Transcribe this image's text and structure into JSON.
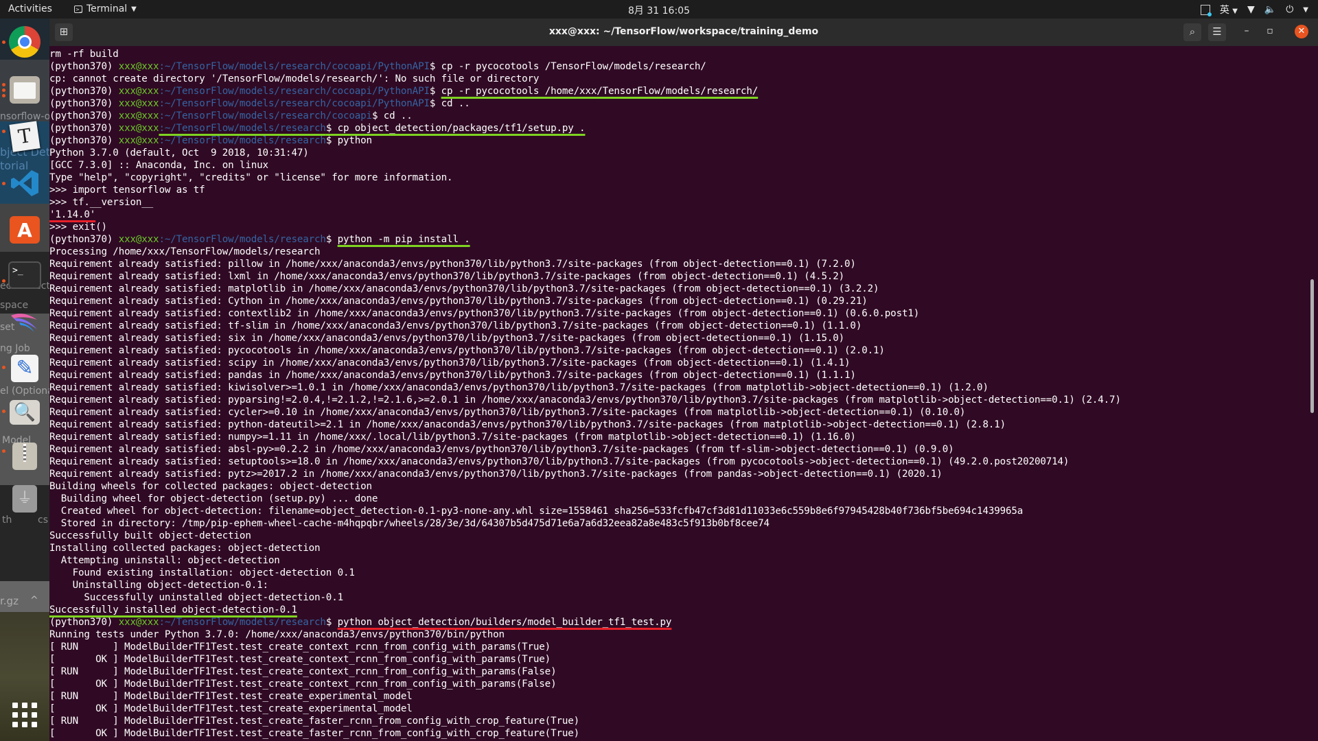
{
  "topbar": {
    "activities": "Activities",
    "app_menu": "Terminal",
    "datetime": "8月 31  16:05",
    "input_method": "英",
    "icons": [
      "screenshot-indicator-icon",
      "wifi-icon",
      "volume-icon",
      "power-icon"
    ]
  },
  "dock": {
    "apps": [
      {
        "name": "Google Chrome",
        "icon": "chrome-icon",
        "running": true
      },
      {
        "name": "Files",
        "icon": "folder-icon",
        "running": true
      },
      {
        "name": "Typora",
        "icon": "typora-icon",
        "running": true
      },
      {
        "name": "Visual Studio Code",
        "icon": "vscode-icon",
        "running": true
      },
      {
        "name": "Ubuntu Software",
        "icon": "software-store-icon",
        "running": false
      },
      {
        "name": "Terminal",
        "icon": "terminal-icon",
        "running": true
      },
      {
        "name": "Kite",
        "icon": "kite-icon",
        "running": false
      },
      {
        "name": "Text Editor",
        "icon": "text-editor-icon",
        "running": true
      },
      {
        "name": "Image Viewer",
        "icon": "image-viewer-icon",
        "running": true
      },
      {
        "name": "Archive Manager",
        "icon": "archive-icon",
        "running": true
      },
      {
        "name": "USB Drive",
        "icon": "usb-icon",
        "running": false
      }
    ],
    "show_apps": "show-applications-icon",
    "background_fragments": [
      "nsorflow-obj",
      "bject Dete",
      "torial",
      "ect Detecto",
      "space",
      "set",
      "ng Job",
      "el (Optional",
      "Model",
      "th",
      "cs!",
      "r.gz"
    ]
  },
  "window": {
    "title": "xxx@xxx: ~/TensorFlow/workspace/training_demo",
    "buttons": {
      "new_tab": "new-tab-icon",
      "search": "search-icon",
      "menu": "hamburger-menu-icon",
      "minimize": "minimize-icon",
      "maximize": "maximize-icon",
      "close": "close-icon"
    }
  },
  "colors": {
    "terminal_bg": "#300a24",
    "prompt_user": "#6bc72a",
    "prompt_path": "#3465a4",
    "underline_green": "#7ed321",
    "underline_red": "#e8202a",
    "close_button": "#e95420"
  },
  "terminal": {
    "lines": [
      {
        "text": "rm -rf build"
      },
      {
        "env": "(python370) ",
        "user": "xxx@xxx",
        "path": ":~/TensorFlow/models/research/cocoapi/PythonAPI",
        "cmd": "$ cp -r pycocotools /TensorFlow/models/research/"
      },
      {
        "text": "cp: cannot create directory '/TensorFlow/models/research/': No such file or directory"
      },
      {
        "env": "(python370) ",
        "user": "xxx@xxx",
        "path": ":~/TensorFlow/models/research/cocoapi/PythonAPI",
        "cmd": "$ ",
        "cmd_marked": "cp -r pycocotools /home/xxx/TensorFlow/models/research/",
        "mark": "green"
      },
      {
        "env": "(python370) ",
        "user": "xxx@xxx",
        "path": ":~/TensorFlow/models/research/cocoapi/PythonAPI",
        "cmd": "$ cd .."
      },
      {
        "env": "(python370) ",
        "user": "xxx@xxx",
        "path": ":~/TensorFlow/models/research/cocoapi",
        "cmd": "$ cd .."
      },
      {
        "env": "(python370) ",
        "user": "xxx@xxx",
        "path": ":~/TensorFlow/models/research",
        "cmd": "$ cp object_detection/packages/tf1/setup.py .",
        "path_marked": true,
        "mark": "green"
      },
      {
        "env": "(python370) ",
        "user": "xxx@xxx",
        "path": ":~/TensorFlow/models/research",
        "cmd": "$ python"
      },
      {
        "text": "Python 3.7.0 (default, Oct  9 2018, 10:31:47)"
      },
      {
        "text": "[GCC 7.3.0] :: Anaconda, Inc. on linux"
      },
      {
        "text": "Type \"help\", \"copyright\", \"credits\" or \"license\" for more information."
      },
      {
        "text": ">>> import tensorflow as tf"
      },
      {
        "text": ">>> tf.__version__"
      },
      {
        "text": "'1.14.0'",
        "mark": "red",
        "whole": true
      },
      {
        "text": ">>> exit()"
      },
      {
        "env": "(python370) ",
        "user": "xxx@xxx",
        "path": ":~/TensorFlow/models/research",
        "cmd": "$ ",
        "cmd_marked": "python -m pip install .",
        "mark": "green"
      },
      {
        "text": "Processing /home/xxx/TensorFlow/models/research"
      },
      {
        "text": "Requirement already satisfied: pillow in /home/xxx/anaconda3/envs/python370/lib/python3.7/site-packages (from object-detection==0.1) (7.2.0)"
      },
      {
        "text": "Requirement already satisfied: lxml in /home/xxx/anaconda3/envs/python370/lib/python3.7/site-packages (from object-detection==0.1) (4.5.2)"
      },
      {
        "text": "Requirement already satisfied: matplotlib in /home/xxx/anaconda3/envs/python370/lib/python3.7/site-packages (from object-detection==0.1) (3.2.2)"
      },
      {
        "text": "Requirement already satisfied: Cython in /home/xxx/anaconda3/envs/python370/lib/python3.7/site-packages (from object-detection==0.1) (0.29.21)"
      },
      {
        "text": "Requirement already satisfied: contextlib2 in /home/xxx/anaconda3/envs/python370/lib/python3.7/site-packages (from object-detection==0.1) (0.6.0.post1)"
      },
      {
        "text": "Requirement already satisfied: tf-slim in /home/xxx/anaconda3/envs/python370/lib/python3.7/site-packages (from object-detection==0.1) (1.1.0)"
      },
      {
        "text": "Requirement already satisfied: six in /home/xxx/anaconda3/envs/python370/lib/python3.7/site-packages (from object-detection==0.1) (1.15.0)"
      },
      {
        "text": "Requirement already satisfied: pycocotools in /home/xxx/anaconda3/envs/python370/lib/python3.7/site-packages (from object-detection==0.1) (2.0.1)"
      },
      {
        "text": "Requirement already satisfied: scipy in /home/xxx/anaconda3/envs/python370/lib/python3.7/site-packages (from object-detection==0.1) (1.4.1)"
      },
      {
        "text": "Requirement already satisfied: pandas in /home/xxx/anaconda3/envs/python370/lib/python3.7/site-packages (from object-detection==0.1) (1.1.1)"
      },
      {
        "text": "Requirement already satisfied: kiwisolver>=1.0.1 in /home/xxx/anaconda3/envs/python370/lib/python3.7/site-packages (from matplotlib->object-detection==0.1) (1.2.0)"
      },
      {
        "text": "Requirement already satisfied: pyparsing!=2.0.4,!=2.1.2,!=2.1.6,>=2.0.1 in /home/xxx/anaconda3/envs/python370/lib/python3.7/site-packages (from matplotlib->object-detection==0.1) (2.4.7)"
      },
      {
        "text": "Requirement already satisfied: cycler>=0.10 in /home/xxx/anaconda3/envs/python370/lib/python3.7/site-packages (from matplotlib->object-detection==0.1) (0.10.0)"
      },
      {
        "text": "Requirement already satisfied: python-dateutil>=2.1 in /home/xxx/anaconda3/envs/python370/lib/python3.7/site-packages (from matplotlib->object-detection==0.1) (2.8.1)"
      },
      {
        "text": "Requirement already satisfied: numpy>=1.11 in /home/xxx/.local/lib/python3.7/site-packages (from matplotlib->object-detection==0.1) (1.16.0)"
      },
      {
        "text": "Requirement already satisfied: absl-py>=0.2.2 in /home/xxx/anaconda3/envs/python370/lib/python3.7/site-packages (from tf-slim->object-detection==0.1) (0.9.0)"
      },
      {
        "text": "Requirement already satisfied: setuptools>=18.0 in /home/xxx/anaconda3/envs/python370/lib/python3.7/site-packages (from pycocotools->object-detection==0.1) (49.2.0.post20200714)"
      },
      {
        "text": "Requirement already satisfied: pytz>=2017.2 in /home/xxx/anaconda3/envs/python370/lib/python3.7/site-packages (from pandas->object-detection==0.1) (2020.1)"
      },
      {
        "text": "Building wheels for collected packages: object-detection"
      },
      {
        "text": "  Building wheel for object-detection (setup.py) ... done"
      },
      {
        "text": "  Created wheel for object-detection: filename=object_detection-0.1-py3-none-any.whl size=1558461 sha256=533fcfb47cf3d81d11033e6c559b8e6f97945428b40f736bf5be694c1439965a"
      },
      {
        "text": "  Stored in directory: /tmp/pip-ephem-wheel-cache-m4hqpqbr/wheels/28/3e/3d/64307b5d475d71e6a7a6d32eea82a8e483c5f913b0bf8cee74"
      },
      {
        "text": "Successfully built object-detection"
      },
      {
        "text": "Installing collected packages: object-detection"
      },
      {
        "text": "  Attempting uninstall: object-detection"
      },
      {
        "text": "    Found existing installation: object-detection 0.1"
      },
      {
        "text": "    Uninstalling object-detection-0.1:"
      },
      {
        "text": "      Successfully uninstalled object-detection-0.1"
      },
      {
        "text": "Successfully installed object-detection-0.1",
        "mark": "green",
        "whole": true
      },
      {
        "env": "(python370) ",
        "user": "xxx@xxx",
        "path": ":~/TensorFlow/models/research",
        "cmd": "$ ",
        "cmd_marked": "python object_detection/builders/model_builder_tf1_test.py",
        "mark": "red"
      },
      {
        "text": "Running tests under Python 3.7.0: /home/xxx/anaconda3/envs/python370/bin/python"
      },
      {
        "text": "[ RUN      ] ModelBuilderTF1Test.test_create_context_rcnn_from_config_with_params(True)"
      },
      {
        "text": "[       OK ] ModelBuilderTF1Test.test_create_context_rcnn_from_config_with_params(True)"
      },
      {
        "text": "[ RUN      ] ModelBuilderTF1Test.test_create_context_rcnn_from_config_with_params(False)"
      },
      {
        "text": "[       OK ] ModelBuilderTF1Test.test_create_context_rcnn_from_config_with_params(False)"
      },
      {
        "text": "[ RUN      ] ModelBuilderTF1Test.test_create_experimental_model"
      },
      {
        "text": "[       OK ] ModelBuilderTF1Test.test_create_experimental_model"
      },
      {
        "text": "[ RUN      ] ModelBuilderTF1Test.test_create_faster_rcnn_from_config_with_crop_feature(True)"
      },
      {
        "text": "[       OK ] ModelBuilderTF1Test.test_create_faster_rcnn_from_config_with_crop_feature(True)"
      }
    ]
  }
}
